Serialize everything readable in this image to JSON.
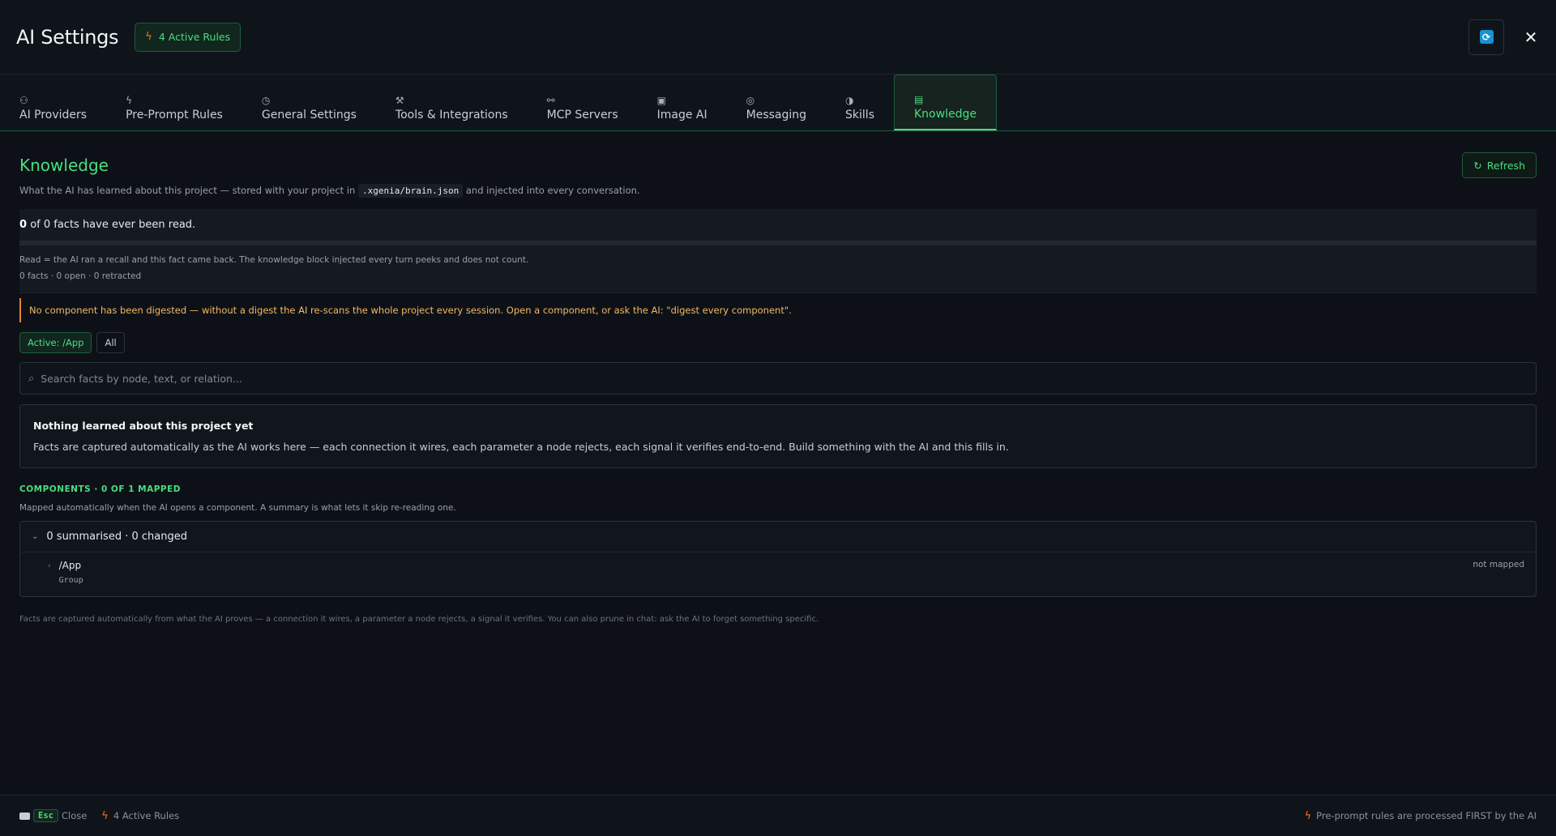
{
  "header": {
    "title": "AI Settings",
    "active_rules_label": "4 Active Rules",
    "close_glyph": "✕"
  },
  "tabs": [
    {
      "label": "AI Providers",
      "icon": "user-robot-icon",
      "glyph": "⚇"
    },
    {
      "label": "Pre-Prompt Rules",
      "icon": "bolt-icon",
      "glyph": "ϟ"
    },
    {
      "label": "General Settings",
      "icon": "clock-icon",
      "glyph": "◷"
    },
    {
      "label": "Tools & Integrations",
      "icon": "wrench-icon",
      "glyph": "⚒"
    },
    {
      "label": "MCP Servers",
      "icon": "plug-icon",
      "glyph": "⚯"
    },
    {
      "label": "Image AI",
      "icon": "image-icon",
      "glyph": "▣"
    },
    {
      "label": "Messaging",
      "icon": "chat-icon",
      "glyph": "◎"
    },
    {
      "label": "Skills",
      "icon": "brain-icon",
      "glyph": "◑"
    },
    {
      "label": "Knowledge",
      "icon": "database-icon",
      "glyph": "▤",
      "active": true
    }
  ],
  "knowledge": {
    "title": "Knowledge",
    "refresh_label": "Refresh",
    "subtitle_before": "What the AI has learned about this project — stored with your project in",
    "subtitle_code": ".xgenia/brain.json",
    "subtitle_after": "and injected into every conversation.",
    "stats_bold": "0",
    "stats_rest": "of 0 facts have ever been read.",
    "stats_note": "Read = the AI ran a recall and this fact came back. The knowledge block injected every turn peeks and does not count.",
    "stats_counts": "0 facts · 0 open · 0 retracted",
    "warning": "No component has been digested — without a digest the AI re-scans the whole project every session. Open a component, or ask the AI: \"digest every component\".",
    "filter_active": "Active: /App",
    "filter_all": "All",
    "search_placeholder": "Search facts by node, text, or relation...",
    "empty_title": "Nothing learned about this project yet",
    "empty_text": "Facts are captured automatically as the AI works here — each connection it wires, each parameter a node rejects, each signal it verifies end-to-end. Build something with the AI and this fills in.",
    "components_label": "COMPONENTS · 0 OF 1 MAPPED",
    "components_sub": "Mapped automatically when the AI opens a component. A summary is what lets it skip re-reading one.",
    "components_summary": "0 summarised · 0 changed",
    "component": {
      "name": "/App",
      "type": "Group",
      "status": "not mapped"
    },
    "footnote": "Facts are captured automatically from what the AI proves — a connection it wires, a parameter a node rejects, a signal it verifies. You can also prune in chat: ask the AI to forget something specific."
  },
  "footer": {
    "esc_key": "Esc",
    "close_label": "Close",
    "rules_label": "4 Active Rules",
    "right_note": "Pre-prompt rules are processed FIRST by the AI"
  },
  "colors": {
    "accent": "#4ade80",
    "warning": "#f4b863",
    "bolt": "#f97316",
    "background": "#0d1117"
  }
}
